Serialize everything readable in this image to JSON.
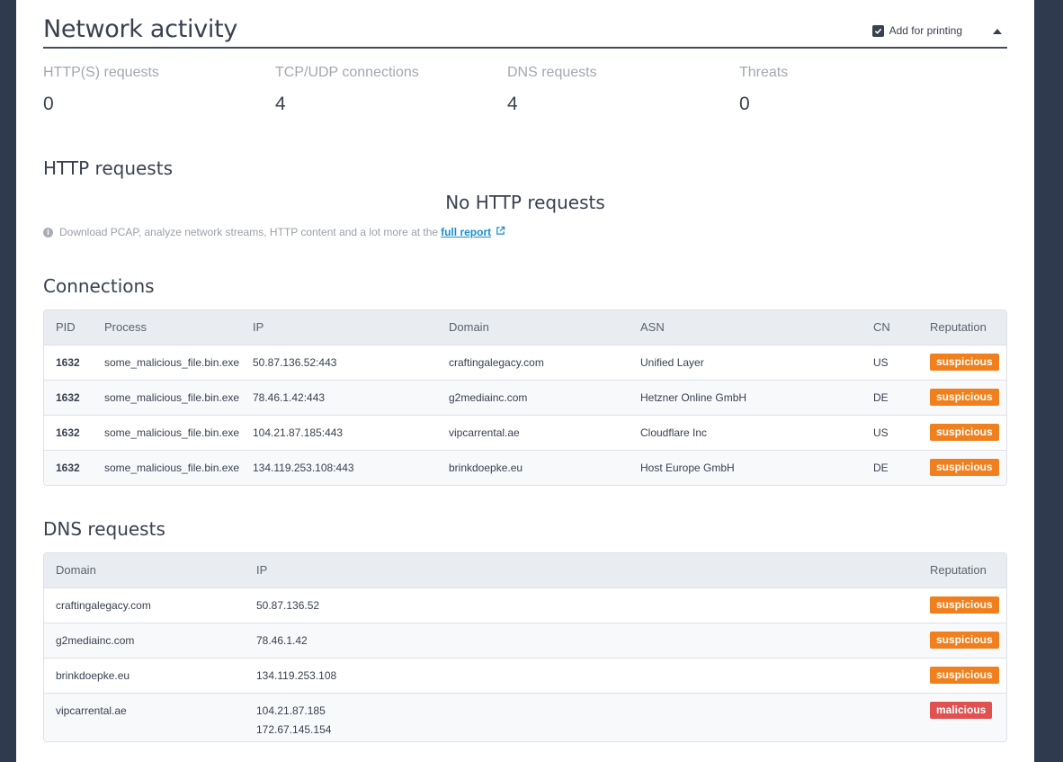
{
  "header": {
    "title": "Network activity",
    "print_label": "Add for printing"
  },
  "stats": [
    {
      "label": "HTTP(S) requests",
      "value": "0"
    },
    {
      "label": "TCP/UDP connections",
      "value": "4"
    },
    {
      "label": "DNS requests",
      "value": "4"
    },
    {
      "label": "Threats",
      "value": "0"
    }
  ],
  "http": {
    "title": "HTTP requests",
    "empty": "No HTTP requests",
    "info_prefix": "Download PCAP, analyze network streams, HTTP content and a lot more at the",
    "info_link": "full report"
  },
  "connections": {
    "title": "Connections",
    "headers": {
      "pid": "PID",
      "process": "Process",
      "ip": "IP",
      "domain": "Domain",
      "asn": "ASN",
      "cn": "CN",
      "reputation": "Reputation"
    },
    "rows": [
      {
        "pid": "1632",
        "process": "some_malicious_file.bin.exe",
        "ip": "50.87.136.52:443",
        "domain": "craftingalegacy.com",
        "asn": "Unified Layer",
        "cn": "US",
        "reputation": "suspicious"
      },
      {
        "pid": "1632",
        "process": "some_malicious_file.bin.exe",
        "ip": "78.46.1.42:443",
        "domain": "g2mediainc.com",
        "asn": "Hetzner Online GmbH",
        "cn": "DE",
        "reputation": "suspicious"
      },
      {
        "pid": "1632",
        "process": "some_malicious_file.bin.exe",
        "ip": "104.21.87.185:443",
        "domain": "vipcarrental.ae",
        "asn": "Cloudflare Inc",
        "cn": "US",
        "reputation": "suspicious"
      },
      {
        "pid": "1632",
        "process": "some_malicious_file.bin.exe",
        "ip": "134.119.253.108:443",
        "domain": "brinkdoepke.eu",
        "asn": "Host Europe GmbH",
        "cn": "DE",
        "reputation": "suspicious"
      }
    ]
  },
  "dns": {
    "title": "DNS requests",
    "headers": {
      "domain": "Domain",
      "ip": "IP",
      "reputation": "Reputation"
    },
    "rows": [
      {
        "domain": "craftingalegacy.com",
        "ip": "50.87.136.52",
        "ip2": "",
        "reputation": "suspicious"
      },
      {
        "domain": "g2mediainc.com",
        "ip": "78.46.1.42",
        "ip2": "",
        "reputation": "suspicious"
      },
      {
        "domain": "brinkdoepke.eu",
        "ip": "134.119.253.108",
        "ip2": "",
        "reputation": "suspicious"
      },
      {
        "domain": "vipcarrental.ae",
        "ip": "104.21.87.185",
        "ip2": "172.67.145.154",
        "reputation": "malicious"
      }
    ]
  },
  "colors": {
    "suspicious": "#f0801e",
    "malicious": "#e05252",
    "link": "#1a8fd0"
  }
}
